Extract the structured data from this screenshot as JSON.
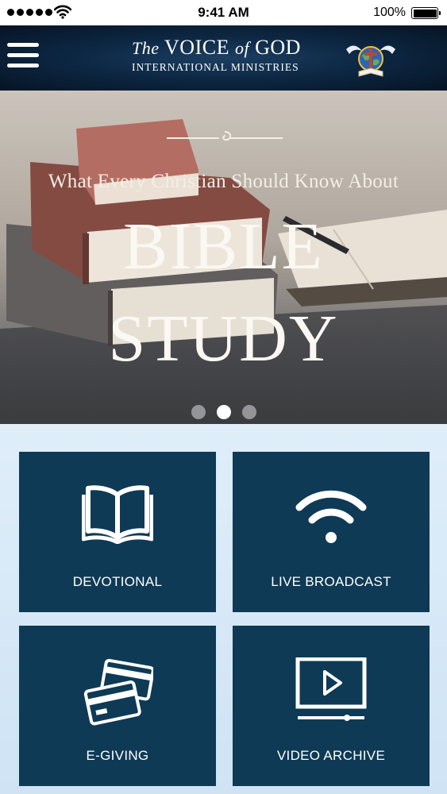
{
  "status_bar": {
    "time": "9:41 AM",
    "battery_percent": "100%",
    "signal_bars": 5,
    "icons": [
      "signal-dots-icon",
      "wifi-icon",
      "battery-icon"
    ]
  },
  "header": {
    "brand_the": "The",
    "brand_voice": "VOICE",
    "brand_of": "of",
    "brand_god": "GOD",
    "brand_subtitle": "INTERNATIONAL MINISTRIES",
    "menu_icon": "hamburger-menu-icon",
    "emblem_icon": "ministry-emblem-icon"
  },
  "hero": {
    "tagline": "What Every Christian Should Know About",
    "title_line1": "BIBLE",
    "title_line2": "STUDY",
    "slides_count": 3,
    "active_slide": 2
  },
  "tiles": [
    {
      "label": "DEVOTIONAL",
      "icon": "open-book-icon"
    },
    {
      "label": "LIVE BROADCAST",
      "icon": "wifi-icon"
    },
    {
      "label": "E-GIVING",
      "icon": "credit-cards-icon"
    },
    {
      "label": "VIDEO ARCHIVE",
      "icon": "video-player-icon"
    }
  ],
  "colors": {
    "header_bg": "#0d2844",
    "tile_bg": "#0e3a55",
    "tiles_area_bg": "#dfeef9",
    "text_light": "#ffffff"
  }
}
